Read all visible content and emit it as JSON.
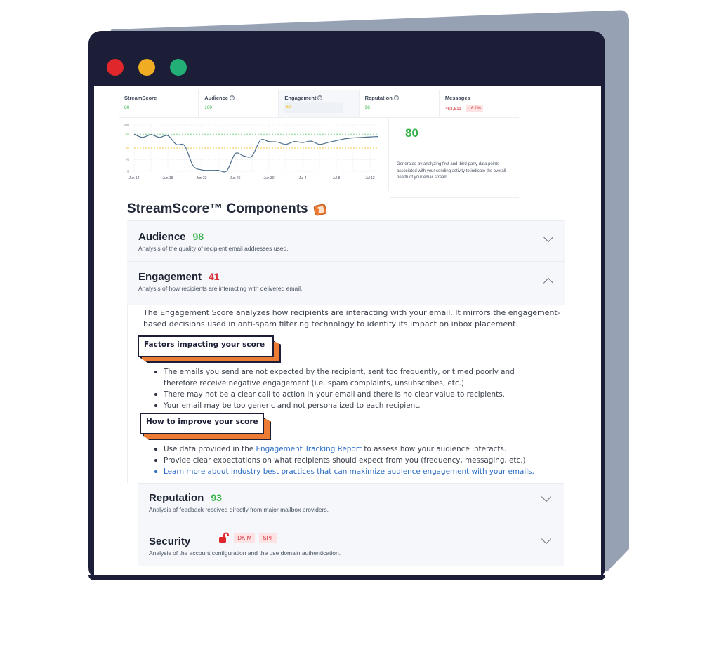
{
  "window": {
    "controls": [
      "close",
      "minimize",
      "maximize"
    ]
  },
  "metrics": [
    {
      "label": "StreamScore",
      "value": "80",
      "status": "green",
      "help": false
    },
    {
      "label": "Audience",
      "value": "100",
      "status": "green",
      "help": true
    },
    {
      "label": "Engagement",
      "value": "69",
      "status": "yellow",
      "help": true,
      "active": true
    },
    {
      "label": "Reputation",
      "value": "98",
      "status": "green",
      "help": true
    },
    {
      "label": "Messages",
      "value": "463,511",
      "status": "red",
      "help": false,
      "delta": "-16.1%"
    }
  ],
  "help_glyph": "?",
  "chart_data": {
    "type": "line",
    "title": "",
    "xlabel": "",
    "ylabel": "",
    "ylim": [
      0,
      100
    ],
    "yticks": [
      0,
      25,
      50,
      80,
      100
    ],
    "xtick_labels": [
      "Jun 14",
      "Jun 18",
      "Jun 22",
      "Jun 26",
      "Jun 30",
      "Jul 4",
      "Jul 8",
      "Jul 12"
    ],
    "x": [
      "Jun 14",
      "Jun 15",
      "Jun 16",
      "Jun 17",
      "Jun 18",
      "Jun 19",
      "Jun 20",
      "Jun 21",
      "Jun 22",
      "Jun 23",
      "Jun 24",
      "Jun 25",
      "Jun 26",
      "Jun 27",
      "Jun 28",
      "Jun 29",
      "Jun 30",
      "Jul 1",
      "Jul 2",
      "Jul 3",
      "Jul 4",
      "Jul 5",
      "Jul 6",
      "Jul 7",
      "Jul 8",
      "Jul 9",
      "Jul 10",
      "Jul 11",
      "Jul 12",
      "Jul 13"
    ],
    "series": [
      {
        "name": "StreamScore",
        "color": "#4a6d8c",
        "values": [
          80,
          73,
          79,
          73,
          77,
          58,
          55,
          12,
          3,
          2,
          2,
          1,
          38,
          33,
          33,
          67,
          64,
          63,
          58,
          64,
          62,
          65,
          58,
          62,
          66,
          70,
          72,
          73,
          74,
          75
        ]
      }
    ],
    "thresholds": [
      {
        "value": 80,
        "color": "#7fd48a",
        "style": "dotted"
      },
      {
        "value": 50,
        "color": "#f5c445",
        "style": "dotted"
      }
    ],
    "grid": true,
    "legend": "none"
  },
  "summary": {
    "score": "80",
    "description": "Generated by analyzing first and third-party data points associated with your sending activity to indicate the overall health of your email stream."
  },
  "components": {
    "title": "StreamScore™ Components",
    "title_icon": "ticket-icon",
    "items": [
      {
        "name": "Audience",
        "score": "98",
        "status": "green",
        "description": "Analysis of the quality of recipient email addresses used.",
        "expanded": false
      },
      {
        "name": "Engagement",
        "score": "41",
        "status": "red",
        "description": "Analysis of how recipients are interacting with delivered email.",
        "expanded": true
      },
      {
        "name": "Reputation",
        "score": "93",
        "status": "green",
        "description": "Analysis of feedback received directly from major mailbox providers.",
        "expanded": false
      },
      {
        "name": "Security",
        "score": "",
        "status": "red",
        "description": "Analysis of the account configuration and the use domain authentication.",
        "expanded": false,
        "lock_icon": "unlocked-icon",
        "badges": [
          "DKIM",
          "SPF"
        ]
      }
    ]
  },
  "engagement_detail": {
    "intro": "The Engagement Score analyzes how recipients are interacting with your email. It mirrors the engagement-based decisions used in anti-spam filtering technology to identify its impact on inbox placement.",
    "factors_heading": "Factors impacting your score",
    "factors": [
      "The emails you send are not expected by the recipient, sent too frequently, or timed poorly and therefore receive negative engagement (i.e. spam complaints, unsubscribes, etc.)",
      "There may not be a clear call to action in your email and there is no clear value to recipients.",
      "Your email may be too generic and not personalized to each recipient."
    ],
    "improve_heading": "How to improve your score",
    "improve": {
      "item1_prefix": "Use data provided in the ",
      "item1_link": "Engagement Tracking Report",
      "item1_suffix": " to assess how your audience interacts.",
      "item2": "Provide clear expectations on what recipients should expect from you (frequency, messaging, etc.)",
      "item3_link": "Learn more about industry best practices that can maximize audience engagement with your emails."
    }
  },
  "colors": {
    "green": "#36b34a",
    "yellow": "#efc21a",
    "red": "#d6313a",
    "link": "#2b6cc4",
    "accent_orange": "#ec7b33",
    "frame": "#1c1d36"
  }
}
